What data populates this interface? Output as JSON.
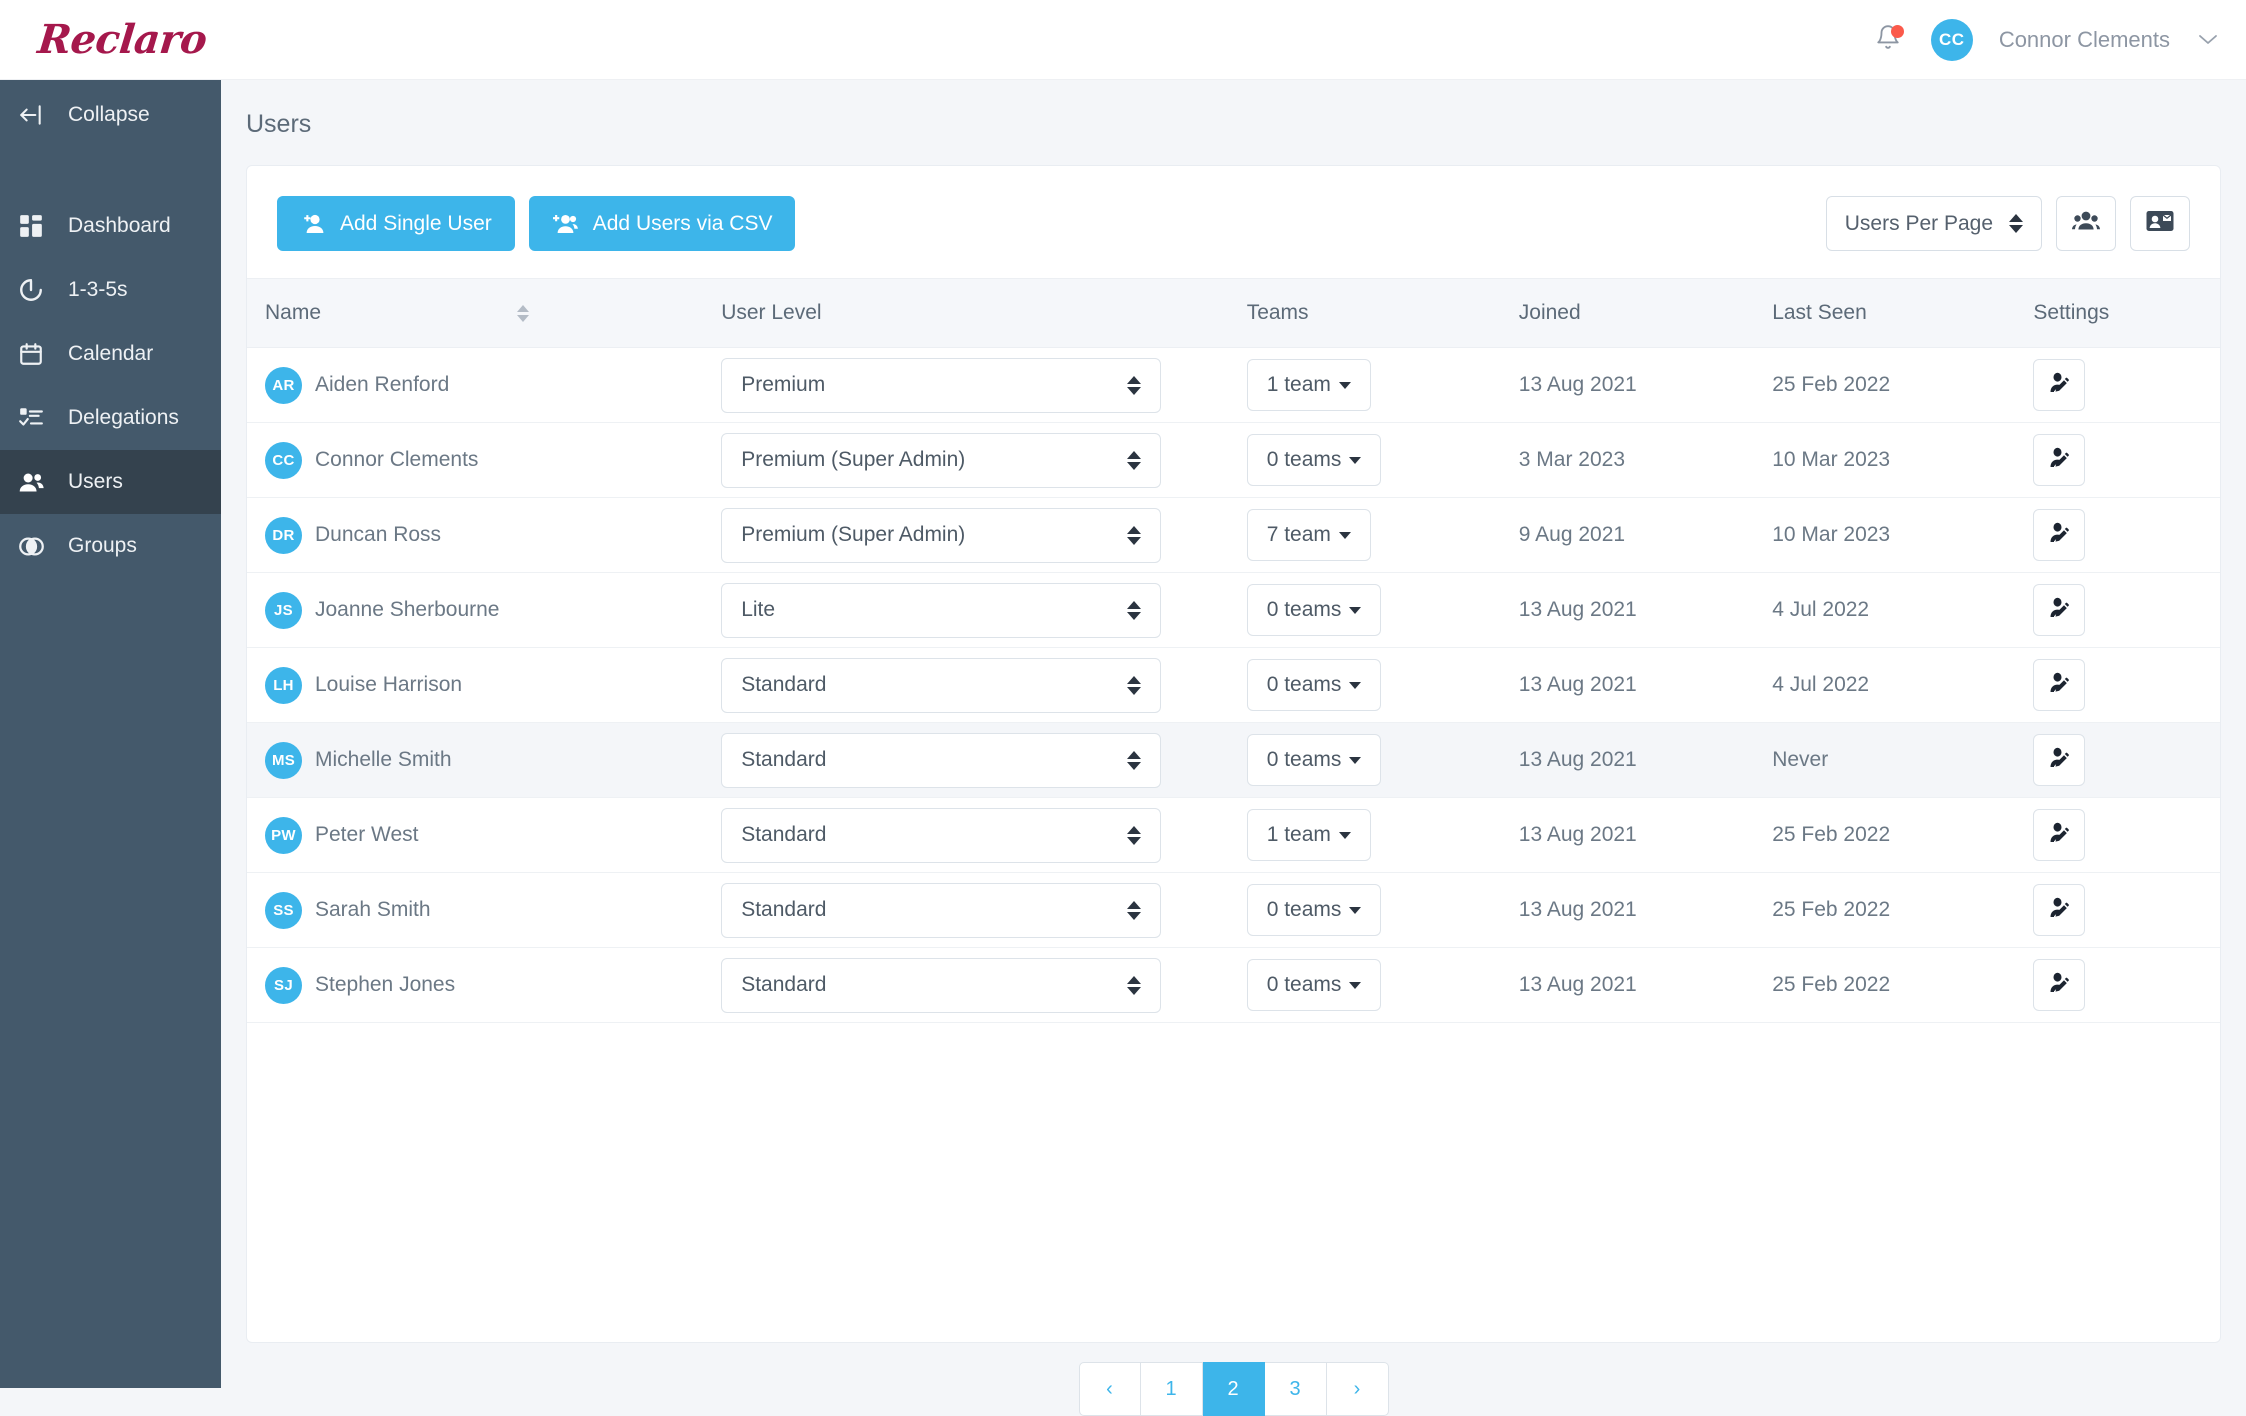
{
  "brand": {
    "logo_text": "Reclaro",
    "accent_blue": "#3db5ea",
    "logo_color": "#a5184c",
    "sidebar_bg": "#44596b"
  },
  "topbar": {
    "notification_icon": "bell-icon",
    "has_notification_dot": true,
    "user_initials": "CC",
    "user_name": "Connor Clements",
    "chevron": "⌄"
  },
  "sidebar": {
    "collapse_label": "Collapse",
    "items": [
      {
        "label": "Dashboard",
        "icon": "dashboard-grid-icon",
        "active": false
      },
      {
        "label": "1-3-5s",
        "icon": "progress-circle-icon",
        "active": false
      },
      {
        "label": "Calendar",
        "icon": "calendar-icon",
        "active": false
      },
      {
        "label": "Delegations",
        "icon": "checklist-icon",
        "active": false
      },
      {
        "label": "Users",
        "icon": "users-icon",
        "active": true
      },
      {
        "label": "Groups",
        "icon": "venn-circles-icon",
        "active": false
      }
    ]
  },
  "page": {
    "title": "Users"
  },
  "toolbar": {
    "add_single_user": "Add Single User",
    "add_users_csv": "Add Users via CSV",
    "users_per_page_label": "Users Per Page",
    "bulk_users_icon": "user-group-icon",
    "invite_card_icon": "contact-card-email-icon"
  },
  "table": {
    "columns": [
      "Name",
      "User Level",
      "Teams",
      "Joined",
      "Last Seen",
      "Settings"
    ],
    "sorted_column": "Name",
    "rows": [
      {
        "initials": "AR",
        "name": "Aiden Renford",
        "level": "Premium",
        "teams": "1 team",
        "joined": "13 Aug 2021",
        "last_seen": "25 Feb 2022",
        "highlight": false
      },
      {
        "initials": "CC",
        "name": "Connor Clements",
        "level": "Premium (Super Admin)",
        "teams": "0 teams",
        "joined": "3 Mar 2023",
        "last_seen": "10 Mar 2023",
        "highlight": false
      },
      {
        "initials": "DR",
        "name": "Duncan Ross",
        "level": "Premium (Super Admin)",
        "teams": "7 team",
        "joined": "9 Aug 2021",
        "last_seen": "10 Mar 2023",
        "highlight": false
      },
      {
        "initials": "JS",
        "name": "Joanne Sherbourne",
        "level": "Lite",
        "teams": "0 teams",
        "joined": "13 Aug 2021",
        "last_seen": "4 Jul 2022",
        "highlight": false
      },
      {
        "initials": "LH",
        "name": "Louise Harrison",
        "level": "Standard",
        "teams": "0 teams",
        "joined": "13 Aug 2021",
        "last_seen": "4 Jul 2022",
        "highlight": false
      },
      {
        "initials": "MS",
        "name": "Michelle Smith",
        "level": "Standard",
        "teams": "0 teams",
        "joined": "13 Aug 2021",
        "last_seen": "Never",
        "highlight": true
      },
      {
        "initials": "PW",
        "name": "Peter West",
        "level": "Standard",
        "teams": "1 team",
        "joined": "13 Aug 2021",
        "last_seen": "25 Feb 2022",
        "highlight": false
      },
      {
        "initials": "SS",
        "name": "Sarah Smith",
        "level": "Standard",
        "teams": "0 teams",
        "joined": "13 Aug 2021",
        "last_seen": "25 Feb 2022",
        "highlight": false
      },
      {
        "initials": "SJ",
        "name": "Stephen Jones",
        "level": "Standard",
        "teams": "0 teams",
        "joined": "13 Aug 2021",
        "last_seen": "25 Feb 2022",
        "highlight": false
      }
    ]
  },
  "pagination": {
    "pages": [
      "‹",
      "1",
      "2",
      "3",
      "›"
    ],
    "active": "2"
  }
}
